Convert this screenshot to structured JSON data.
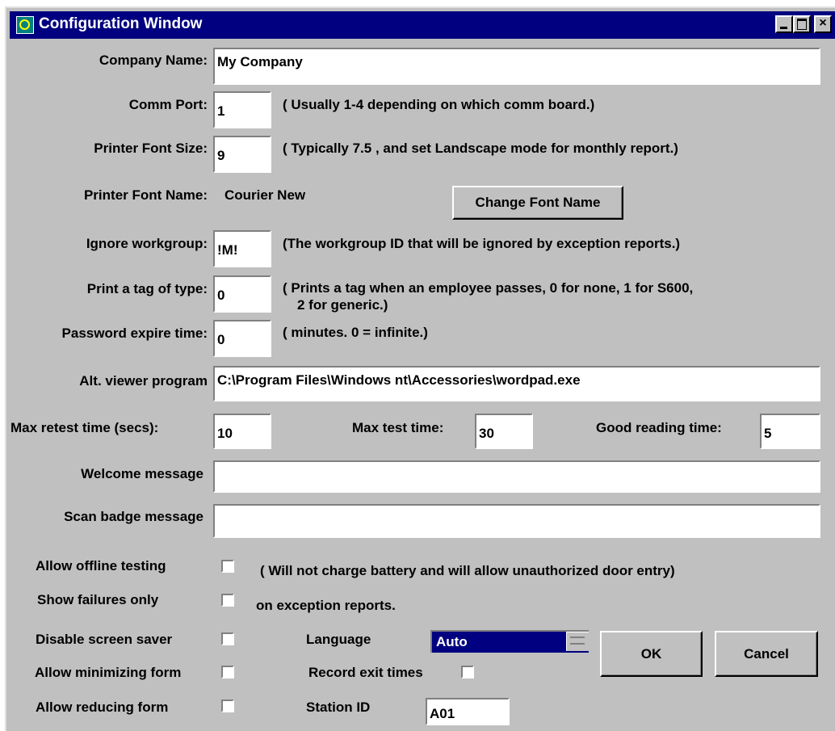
{
  "window": {
    "title": "Configuration Window"
  },
  "form": {
    "company_name": {
      "label": "Company Name:",
      "value": "My Company"
    },
    "comm_port": {
      "label": "Comm Port:",
      "value": "1",
      "note": "( Usually 1-4 depending on which comm board.)"
    },
    "printer_font_size": {
      "label": "Printer Font Size:",
      "value": "9",
      "note": "( Typically 7.5 , and set Landscape mode for monthly report.)"
    },
    "printer_font_name": {
      "label": "Printer Font Name:",
      "value": "Courier New",
      "button": "Change Font Name"
    },
    "ignore_workgroup": {
      "label": "Ignore workgroup:",
      "value": "!M!",
      "note": "(The workgroup ID that will be ignored by exception reports.)"
    },
    "print_tag": {
      "label": "Print a tag of type:",
      "value": "0",
      "note_line1": "( Prints a tag when an employee passes, 0 for none, 1 for S600,",
      "note_line2": "2 for generic.)"
    },
    "password_expire": {
      "label": "Password expire time:",
      "value": "0",
      "note": "( minutes.  0 = infinite.)"
    },
    "alt_viewer": {
      "label": "Alt. viewer program",
      "value": "C:\\Program Files\\Windows nt\\Accessories\\wordpad.exe"
    },
    "max_retest": {
      "label": "Max retest time (secs):",
      "value": "10"
    },
    "max_test": {
      "label": "Max test time:",
      "value": "30"
    },
    "good_reading": {
      "label": "Good reading time:",
      "value": "5"
    },
    "welcome_message": {
      "label": "Welcome message",
      "value": ""
    },
    "scan_badge_message": {
      "label": "Scan badge message",
      "value": ""
    },
    "allow_offline": {
      "label": "Allow offline testing",
      "checked": false,
      "note": "( Will not charge battery and will allow unauthorized door entry)"
    },
    "show_failures": {
      "label": "Show failures only",
      "checked": false,
      "note": "on exception reports."
    },
    "disable_screensaver": {
      "label": "Disable screen saver",
      "checked": false
    },
    "allow_minimizing": {
      "label": "Allow minimizing form",
      "checked": false
    },
    "allow_reducing": {
      "label": "Allow reducing form",
      "checked": false
    },
    "language": {
      "label": "Language",
      "value": "Auto"
    },
    "record_exit": {
      "label": "Record exit times",
      "checked": false
    },
    "station_id": {
      "label": "Station ID",
      "value": "A01"
    }
  },
  "buttons": {
    "ok": "OK",
    "cancel": "Cancel"
  },
  "colors": {
    "titlebar": "#000080",
    "face": "#c0c0c0",
    "selection": "#000080"
  },
  "icons": [
    "app-icon",
    "minimize-icon",
    "maximize-icon",
    "close-icon"
  ]
}
